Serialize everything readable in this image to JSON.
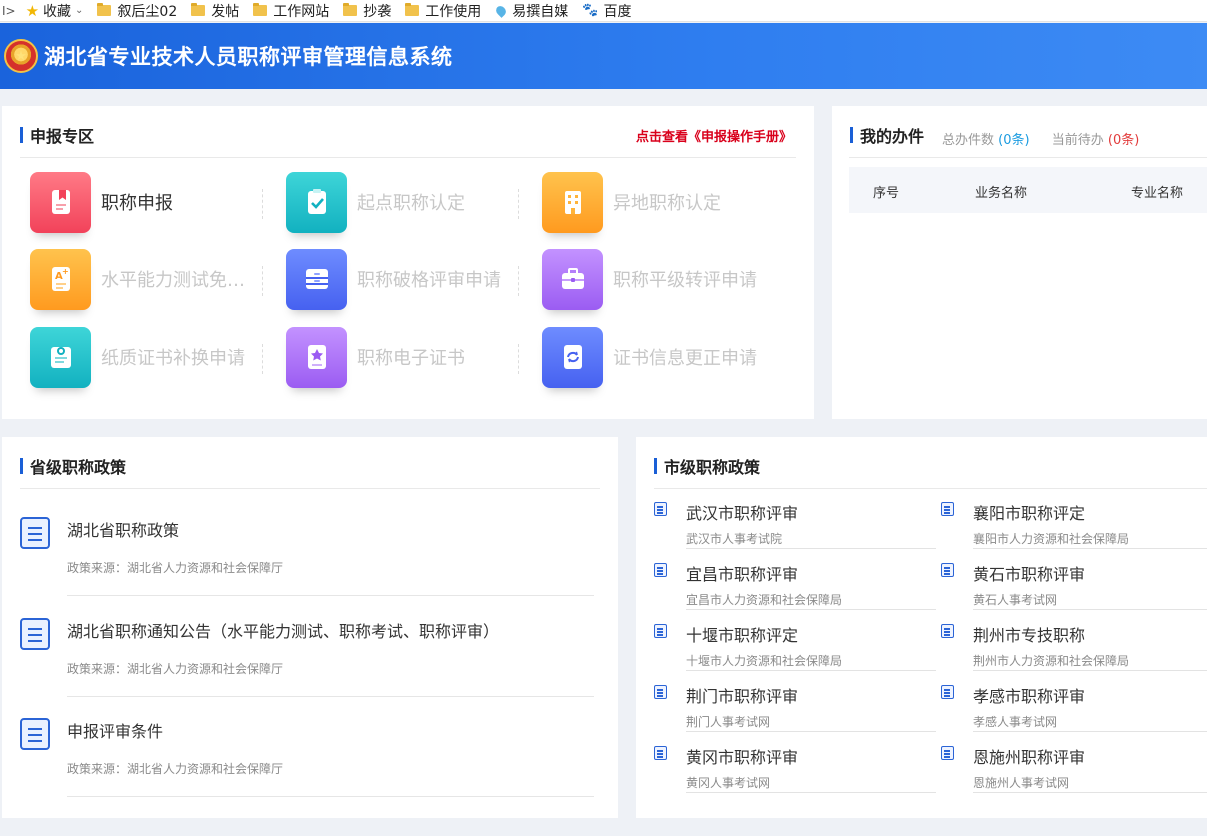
{
  "bookmarks": [
    {
      "label": "收藏",
      "icon": "star-icon"
    },
    {
      "label": "叙后尘02",
      "icon": "folder-icon"
    },
    {
      "label": "发帖",
      "icon": "folder-icon"
    },
    {
      "label": "工作网站",
      "icon": "folder-icon"
    },
    {
      "label": "抄袭",
      "icon": "folder-icon"
    },
    {
      "label": "工作使用",
      "icon": "folder-icon"
    },
    {
      "label": "易撰自媒",
      "icon": "pin-icon"
    },
    {
      "label": "百度",
      "icon": "baidu-paw-icon"
    }
  ],
  "header": {
    "title": "湖北省专业技术人员职称评审管理信息系统"
  },
  "apply": {
    "title": "申报专区",
    "manual_link": "点击查看《申报操作手册》",
    "items": [
      {
        "label": "职称申报",
        "icon": "bookmark-doc-icon",
        "color": "#f2425a",
        "active": true
      },
      {
        "label": "起点职称认定",
        "icon": "clipboard-check-icon",
        "color": "#12b1c0",
        "active": false
      },
      {
        "label": "异地职称认定",
        "icon": "building-icon",
        "color": "#ff9a1f",
        "active": false
      },
      {
        "label": "水平能力测试免…",
        "icon": "grade-a-plus-icon",
        "color": "#ff9a1f",
        "active": false
      },
      {
        "label": "职称破格评审申请",
        "icon": "drawer-icon",
        "color": "#4661f0",
        "active": false
      },
      {
        "label": "职称平级转评申请",
        "icon": "briefcase-icon",
        "color": "#9b5cf2",
        "active": false
      },
      {
        "label": "纸质证书补换申请",
        "icon": "certificate-icon",
        "color": "#12b1c0",
        "active": false
      },
      {
        "label": "职称电子证书",
        "icon": "star-badge-icon",
        "color": "#9b5cf2",
        "active": false
      },
      {
        "label": "证书信息更正申请",
        "icon": "refresh-doc-icon",
        "color": "#4661f0",
        "active": false
      }
    ]
  },
  "work": {
    "title": "我的办件",
    "total_label": "总办件数",
    "total_value": "(0条)",
    "pending_label": "当前待办",
    "pending_value": "(0条)",
    "columns": [
      "序号",
      "业务名称",
      "专业名称"
    ]
  },
  "provincial": {
    "title": "省级职称政策",
    "items": [
      {
        "title": "湖北省职称政策",
        "source": "政策来源：湖北省人力资源和社会保障厅"
      },
      {
        "title": "湖北省职称通知公告（水平能力测试、职称考试、职称评审）",
        "source": "政策来源：湖北省人力资源和社会保障厅"
      },
      {
        "title": "申报评审条件",
        "source": "政策来源：湖北省人力资源和社会保障厅"
      }
    ]
  },
  "city": {
    "title": "市级职称政策",
    "items": [
      {
        "title": "武汉市职称评审",
        "source": "武汉市人事考试院"
      },
      {
        "title": "襄阳市职称评定",
        "source": "襄阳市人力资源和社会保障局"
      },
      {
        "title": "宜昌市职称评审",
        "source": "宜昌市人力资源和社会保障局"
      },
      {
        "title": "黄石市职称评审",
        "source": "黄石人事考试网"
      },
      {
        "title": "十堰市职称评定",
        "source": "十堰市人力资源和社会保障局"
      },
      {
        "title": "荆州市专技职称",
        "source": "荆州市人力资源和社会保障局"
      },
      {
        "title": "荆门市职称评审",
        "source": "荆门人事考试网"
      },
      {
        "title": "孝感市职称评审",
        "source": "孝感人事考试网"
      },
      {
        "title": "黄冈市职称评审",
        "source": "黄冈人事考试网"
      },
      {
        "title": "恩施州职称评审",
        "source": "恩施州人事考试网"
      }
    ]
  }
}
